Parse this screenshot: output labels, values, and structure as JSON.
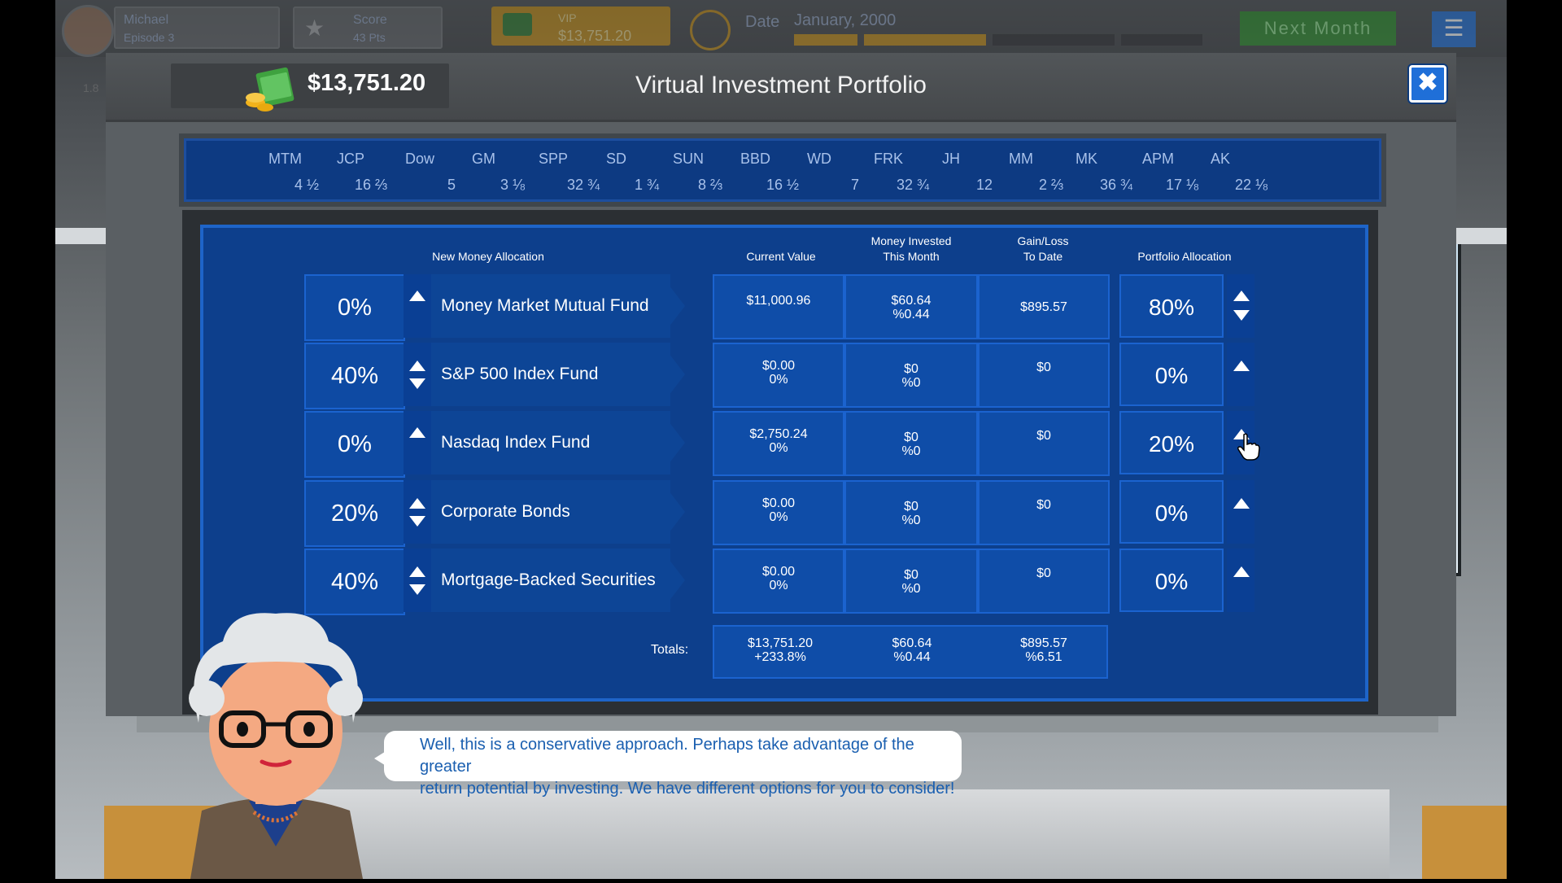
{
  "hud": {
    "player_name": "Michael",
    "episode": "Episode 3",
    "score_label": "Score",
    "score_value": "43 Pts",
    "vip_label": "VIP",
    "vip_value": "$13,751.20",
    "date_label": "Date",
    "date_value": "January, 2000",
    "next_month_label": "Next Month",
    "side_value": "1.8"
  },
  "header": {
    "money": "$13,751.20",
    "title": "Virtual Investment Portfolio"
  },
  "ticker": [
    {
      "symbol": "MTM",
      "value": "4 ½"
    },
    {
      "symbol": "JCP",
      "value": "16 ⅔"
    },
    {
      "symbol": "Dow",
      "value": "5"
    },
    {
      "symbol": "GM",
      "value": "3 ⅛"
    },
    {
      "symbol": "SPP",
      "value": "32 ¾"
    },
    {
      "symbol": "SD",
      "value": "1 ¾"
    },
    {
      "symbol": "SUN",
      "value": "8 ⅔"
    },
    {
      "symbol": "BBD",
      "value": "16 ½"
    },
    {
      "symbol": "WD",
      "value": "7"
    },
    {
      "symbol": "FRK",
      "value": "32 ¾"
    },
    {
      "symbol": "JH",
      "value": "12"
    },
    {
      "symbol": "MM",
      "value": "2 ⅔"
    },
    {
      "symbol": "MK",
      "value": "36 ¾"
    },
    {
      "symbol": "APM",
      "value": "17 ⅛"
    },
    {
      "symbol": "AK",
      "value": "22 ⅛"
    }
  ],
  "columns": {
    "new_money": "New Money Allocation",
    "current_value": "Current Value",
    "money_invested_1": "Money Invested",
    "money_invested_2": "This Month",
    "gain_loss_1": "Gain/Loss",
    "gain_loss_2": "To Date",
    "portfolio_allocation": "Portfolio Allocation"
  },
  "rows": [
    {
      "new_pct": "0%",
      "fund": "Money Market Mutual Fund",
      "cv1": "$11,000.96",
      "cv2": "",
      "mi1": "$60.64",
      "mi2": "%0.44",
      "gl": "$895.57",
      "alloc": "80%"
    },
    {
      "new_pct": "40%",
      "fund": "S&P 500 Index Fund",
      "cv1": "$0.00",
      "cv2": "0%",
      "mi1": "$0",
      "mi2": "%0",
      "gl": "$0",
      "alloc": "0%"
    },
    {
      "new_pct": "0%",
      "fund": "Nasdaq Index Fund",
      "cv1": "$2,750.24",
      "cv2": "0%",
      "mi1": "$0",
      "mi2": "%0",
      "gl": "$0",
      "alloc": "20%"
    },
    {
      "new_pct": "20%",
      "fund": "Corporate Bonds",
      "cv1": "$0.00",
      "cv2": "0%",
      "mi1": "$0",
      "mi2": "%0",
      "gl": "$0",
      "alloc": "0%"
    },
    {
      "new_pct": "40%",
      "fund": "Mortgage-Backed Securities",
      "cv1": "$0.00",
      "cv2": "0%",
      "mi1": "$0",
      "mi2": "%0",
      "gl": "$0",
      "alloc": "0%"
    }
  ],
  "totals": {
    "label": "Totals:",
    "cv1": "$13,751.20",
    "cv2": "+233.8%",
    "mi1": "$60.64",
    "mi2": "%0.44",
    "gl1": "$895.57",
    "gl2": "%6.51"
  },
  "dialog": {
    "line1": "Well, this is a conservative approach. Perhaps take advantage of the greater",
    "line2": "return potential by investing. We have different options for you to consider!"
  },
  "colors": {
    "board": "#0d3f8c",
    "accent": "#1f6fd8",
    "next_month": "#2a8a2a",
    "vip": "#c08a16"
  }
}
